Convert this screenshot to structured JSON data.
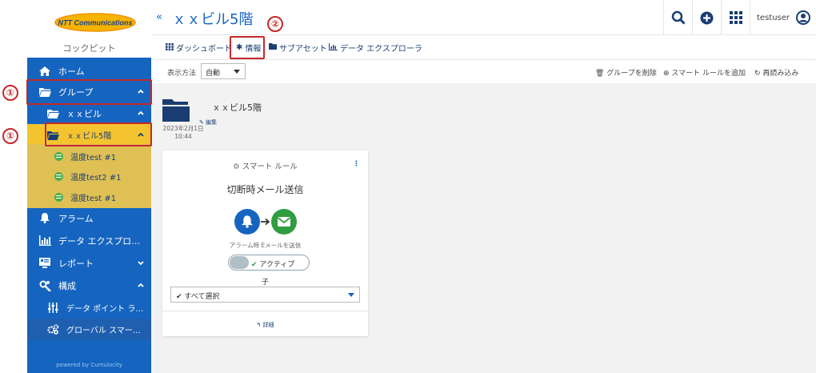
{
  "sidebar": {
    "logo_text": "NTT Communications",
    "cockpit": "コックピット",
    "items": [
      {
        "label": "ホーム",
        "icon": "home-icon"
      },
      {
        "label": "グループ",
        "icon": "folder-open-icon"
      },
      {
        "label": "ｘｘビル",
        "icon": "folder-open-icon"
      },
      {
        "label": "ｘｘビル5階",
        "icon": "folder-open-icon"
      },
      {
        "label": "アラーム",
        "icon": "bell-icon"
      },
      {
        "label": "データ エクスプロ…",
        "icon": "bar-chart-icon"
      },
      {
        "label": "レポート",
        "icon": "report-icon"
      },
      {
        "label": "構成",
        "icon": "config-icon"
      },
      {
        "label": "データ ポイント ラ…",
        "icon": "sliders-icon"
      },
      {
        "label": "グローバル スマー…",
        "icon": "cogs-icon"
      }
    ],
    "leaves": [
      {
        "label": "温度test #1"
      },
      {
        "label": "温度test2 #1"
      },
      {
        "label": "温度test #1"
      }
    ],
    "powered_by": "powered by Cumulocity"
  },
  "annotations": {
    "marker_1": "①",
    "marker_2": "②",
    "color": "#c62828"
  },
  "header": {
    "collapse": "«",
    "title": "ｘｘビル5階",
    "username": "testuser"
  },
  "tabs": [
    {
      "label": "ダッシュボード",
      "icon": "grid-icon"
    },
    {
      "label": "情報",
      "icon": "asterisk-icon"
    },
    {
      "label": "サブアセット",
      "icon": "folder-icon"
    },
    {
      "label": "データ エクスプローラ",
      "icon": "bar-chart-icon"
    }
  ],
  "toolbar": {
    "view_label": "表示方法",
    "view_value": "自動",
    "delete_group": "グループを削除",
    "add_smart_rule": "スマート ルールを追加",
    "reload": "再読み込み"
  },
  "group": {
    "name": "ｘｘビル5階",
    "edit": "編集",
    "date": "2023年2月1日",
    "time": "10:44"
  },
  "card": {
    "header": "スマート ルール",
    "menu": "⋮",
    "title": "切断時メール送信",
    "caption": "アラーム時 Eメールを送信",
    "toggle_label": "アクティブ",
    "child_label": "子",
    "select_value": "すべて選択",
    "details": "詳細"
  },
  "colors": {
    "primary": "#1565c0",
    "yellow": "#f4c430",
    "green": "#2e9d3f"
  }
}
